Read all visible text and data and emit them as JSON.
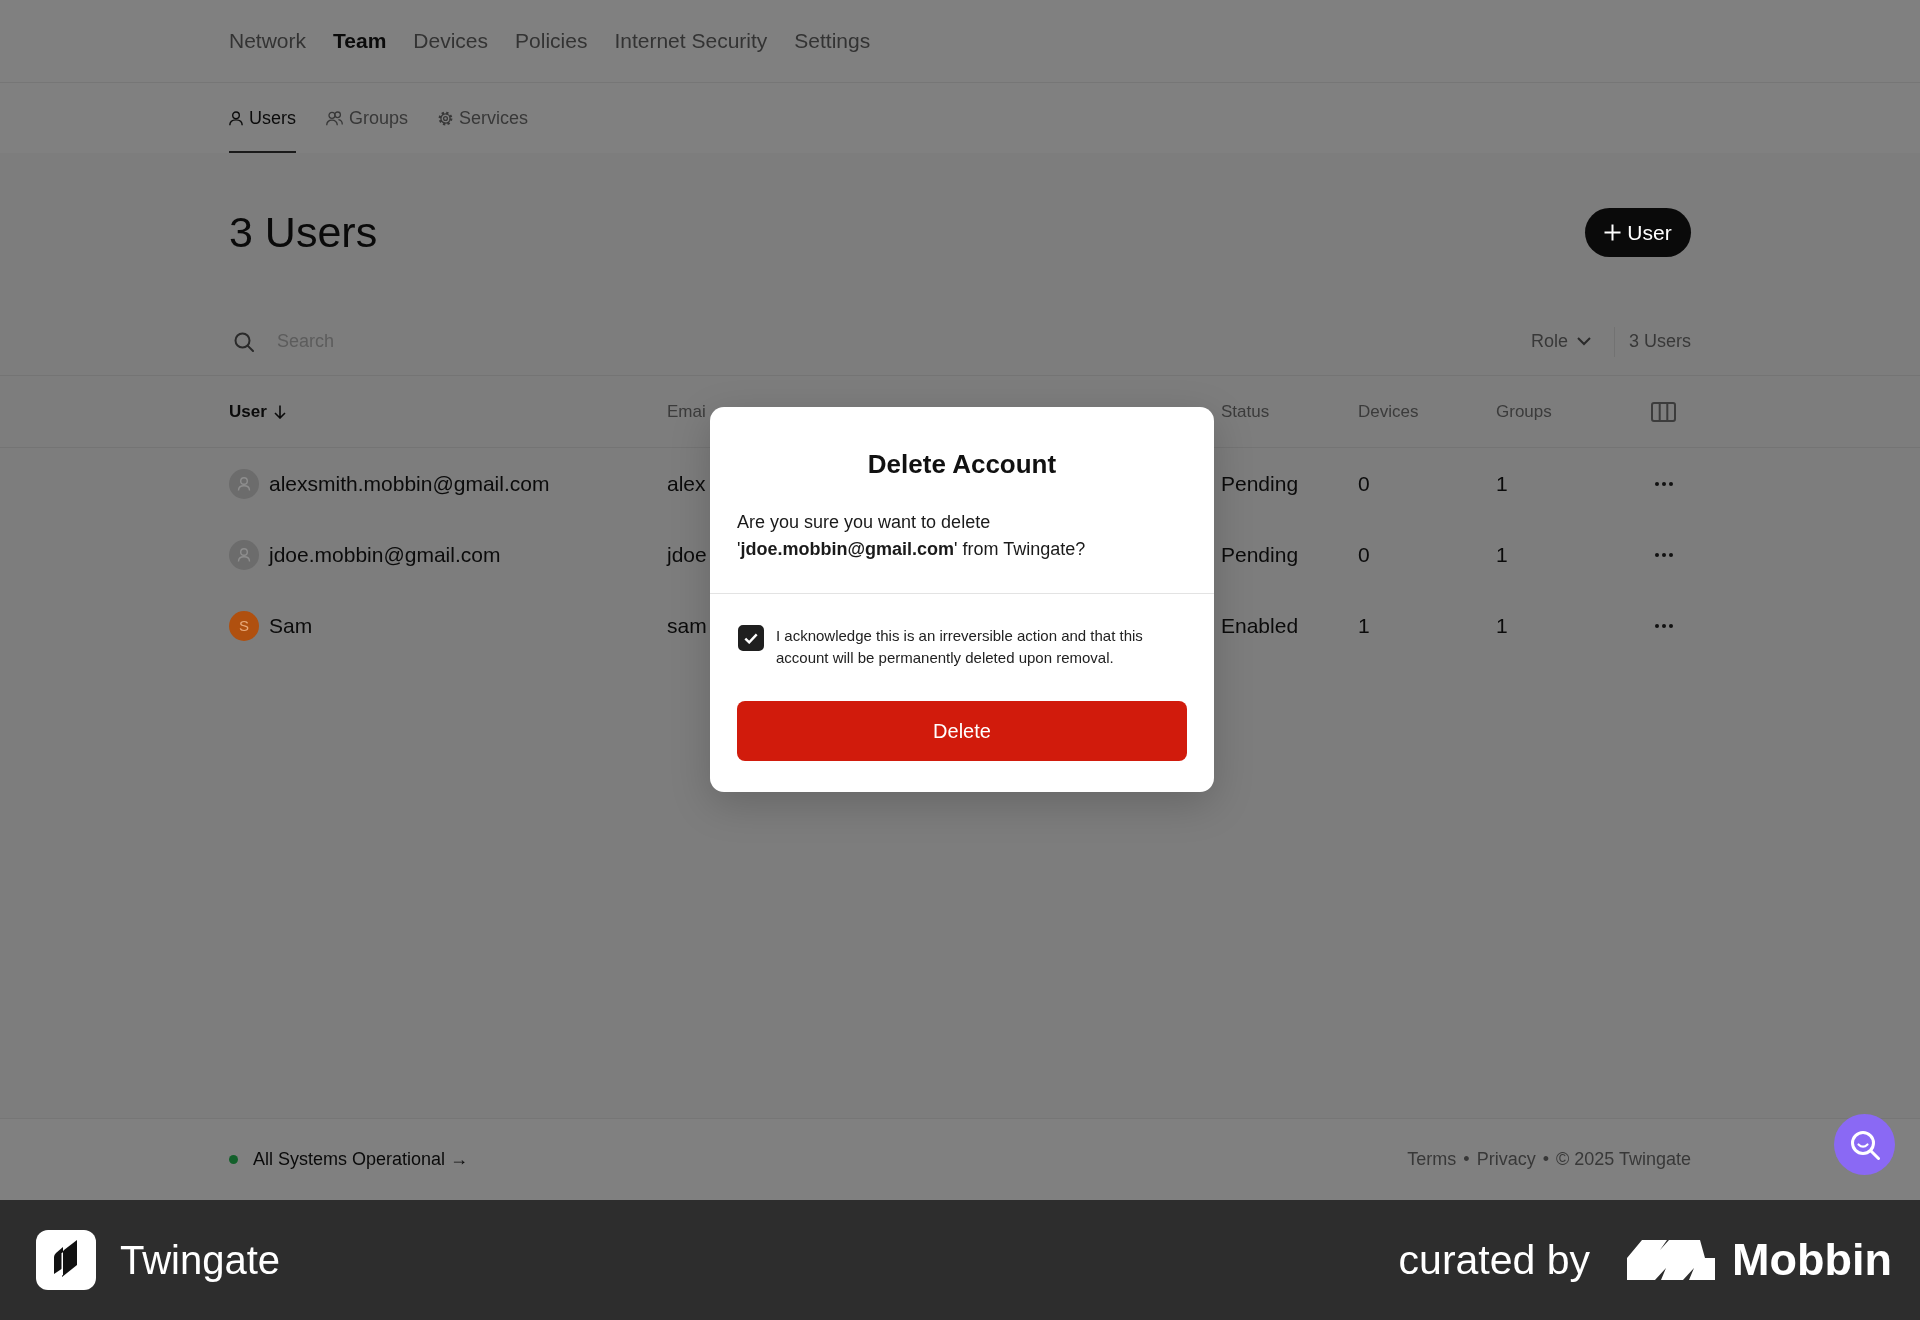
{
  "top_nav": [
    {
      "label": "Network",
      "selected": false
    },
    {
      "label": "Team",
      "selected": true
    },
    {
      "label": "Devices",
      "selected": false
    },
    {
      "label": "Policies",
      "selected": false
    },
    {
      "label": "Internet Security",
      "selected": false
    },
    {
      "label": "Settings",
      "selected": false
    }
  ],
  "sub_tabs": [
    {
      "label": "Users",
      "selected": true
    },
    {
      "label": "Groups",
      "selected": false
    },
    {
      "label": "Services",
      "selected": false
    }
  ],
  "page_title": "3 Users",
  "add_button": {
    "label": "User"
  },
  "filter_bar": {
    "search": {
      "placeholder": "Search"
    },
    "role_filter": {
      "label": "Role"
    },
    "count": "3 Users"
  },
  "table": {
    "columns": [
      {
        "label": "User",
        "sorted": true
      },
      {
        "label": "Emai",
        "sorted": false
      },
      {
        "label": "Status",
        "sorted": false
      },
      {
        "label": "Devices",
        "sorted": false
      },
      {
        "label": "Groups",
        "sorted": false
      }
    ],
    "rows": [
      {
        "avatar": {
          "kind": "placeholder"
        },
        "user": "alexsmith.mobbin@gmail.com",
        "email": "alex",
        "status": "Pending",
        "devices": "0",
        "groups": "1"
      },
      {
        "avatar": {
          "kind": "placeholder"
        },
        "user": "jdoe.mobbin@gmail.com",
        "email": "jdoe",
        "status": "Pending",
        "devices": "0",
        "groups": "1"
      },
      {
        "avatar": {
          "kind": "initial",
          "initial": "S",
          "color": "#b0500f"
        },
        "user": "Sam",
        "email": "sam",
        "status": "Enabled",
        "devices": "1",
        "groups": "1"
      }
    ]
  },
  "modal": {
    "title": "Delete Account",
    "message": "Are you sure you want to delete '**jdoe.mobbin@gmail.com**' from Twingate?",
    "acknowledge": {
      "label": "I acknowledge this is an irreversible action and that this account will be permanently deleted upon removal.",
      "checked": true
    },
    "confirm_button": {
      "label": "Delete"
    }
  },
  "footer": {
    "status": "All Systems Operational →",
    "links": [
      {
        "text": "Terms",
        "separator": "•"
      },
      {
        "text": "Privacy",
        "separator": "•"
      }
    ],
    "copyright": "© 2025 Twingate"
  },
  "brand_bar": {
    "app_name": "Twingate",
    "curated_label": "curated by",
    "curator": "Mobbin"
  }
}
